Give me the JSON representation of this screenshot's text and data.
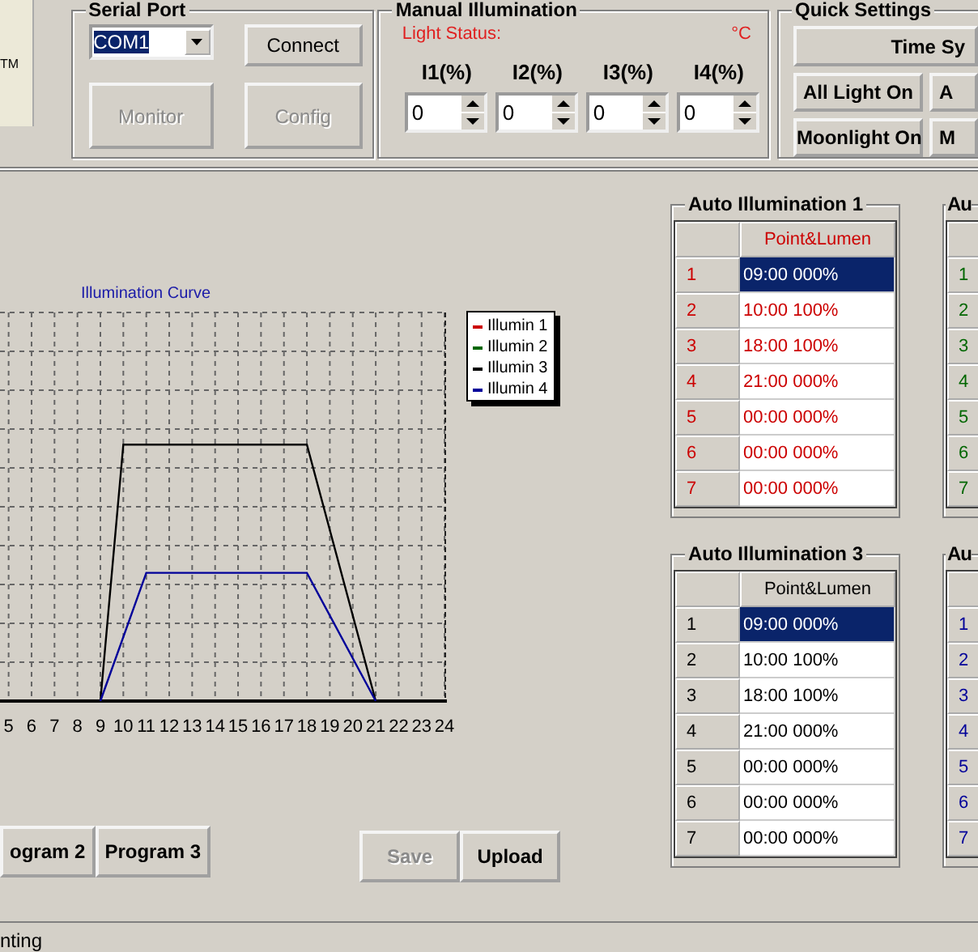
{
  "left_panel": {
    "text": "TM"
  },
  "serial_port": {
    "title": "Serial Port",
    "port": "COM1",
    "buttons": [
      {
        "label": "Connect",
        "disabled": false
      },
      {
        "label": "Monitor",
        "disabled": true
      },
      {
        "label": "Config",
        "disabled": true
      }
    ]
  },
  "manual_illumination": {
    "title": "Manual Illumination",
    "light_status": "Light Status:",
    "temperature_unit": "°C",
    "channels": [
      {
        "label": "I1(%)",
        "value": "0"
      },
      {
        "label": "I2(%)",
        "value": "0"
      },
      {
        "label": "I3(%)",
        "value": "0"
      },
      {
        "label": "I4(%)",
        "value": "0"
      }
    ]
  },
  "quick_settings": {
    "title": "Quick Settings",
    "buttons": [
      {
        "label": "Time Sy"
      },
      {
        "label": "All Light On"
      },
      {
        "label": "A"
      },
      {
        "label": "Moonlight On"
      },
      {
        "label": "M"
      }
    ]
  },
  "chart": {
    "title": "Illumination Curve",
    "legend": [
      {
        "name": "Illumin 1",
        "color": "#cc0000"
      },
      {
        "name": "Illumin 2",
        "color": "#006600"
      },
      {
        "name": "Illumin 3",
        "color": "#000000"
      },
      {
        "name": "Illumin 4",
        "color": "#000099"
      }
    ],
    "x_tick_labels": [
      "5",
      "6",
      "7",
      "8",
      "9",
      "10",
      "11",
      "12",
      "13",
      "14",
      "15",
      "16",
      "17",
      "18",
      "19",
      "20",
      "21",
      "22",
      "23",
      "24"
    ]
  },
  "tables": [
    {
      "title": "Auto Illumination 1",
      "color": "#cc0000",
      "header": "Point&Lumen",
      "rows": [
        {
          "index": "1",
          "value": "09:00 000%",
          "selected": true
        },
        {
          "index": "2",
          "value": "10:00 100%",
          "selected": false
        },
        {
          "index": "3",
          "value": "18:00 100%",
          "selected": false
        },
        {
          "index": "4",
          "value": "21:00 000%",
          "selected": false
        },
        {
          "index": "5",
          "value": "00:00 000%",
          "selected": false
        },
        {
          "index": "6",
          "value": "00:00 000%",
          "selected": false
        },
        {
          "index": "7",
          "value": "00:00 000%",
          "selected": false
        }
      ]
    },
    {
      "title": "Au",
      "color": "#006600",
      "rows": [
        {
          "index": "1"
        },
        {
          "index": "2"
        },
        {
          "index": "3"
        },
        {
          "index": "4"
        },
        {
          "index": "5"
        },
        {
          "index": "6"
        },
        {
          "index": "7"
        }
      ]
    },
    {
      "title": "Auto Illumination 3",
      "color": "#000000",
      "header": "Point&Lumen",
      "rows": [
        {
          "index": "1",
          "value": "09:00 000%",
          "selected": true
        },
        {
          "index": "2",
          "value": "10:00 100%",
          "selected": false
        },
        {
          "index": "3",
          "value": "18:00 100%",
          "selected": false
        },
        {
          "index": "4",
          "value": "21:00 000%",
          "selected": false
        },
        {
          "index": "5",
          "value": "00:00 000%",
          "selected": false
        },
        {
          "index": "6",
          "value": "00:00 000%",
          "selected": false
        },
        {
          "index": "7",
          "value": "00:00 000%",
          "selected": false
        }
      ]
    },
    {
      "title": "Au",
      "color": "#000099",
      "rows": [
        {
          "index": "1"
        },
        {
          "index": "2"
        },
        {
          "index": "3"
        },
        {
          "index": "4"
        },
        {
          "index": "5"
        },
        {
          "index": "6"
        },
        {
          "index": "7"
        }
      ]
    }
  ],
  "program_buttons": [
    {
      "label": "ogram 2"
    },
    {
      "label": "Program 3"
    }
  ],
  "actions": [
    {
      "label": "Save",
      "disabled": true
    },
    {
      "label": "Upload",
      "disabled": false
    }
  ],
  "status_bar": "nting"
}
